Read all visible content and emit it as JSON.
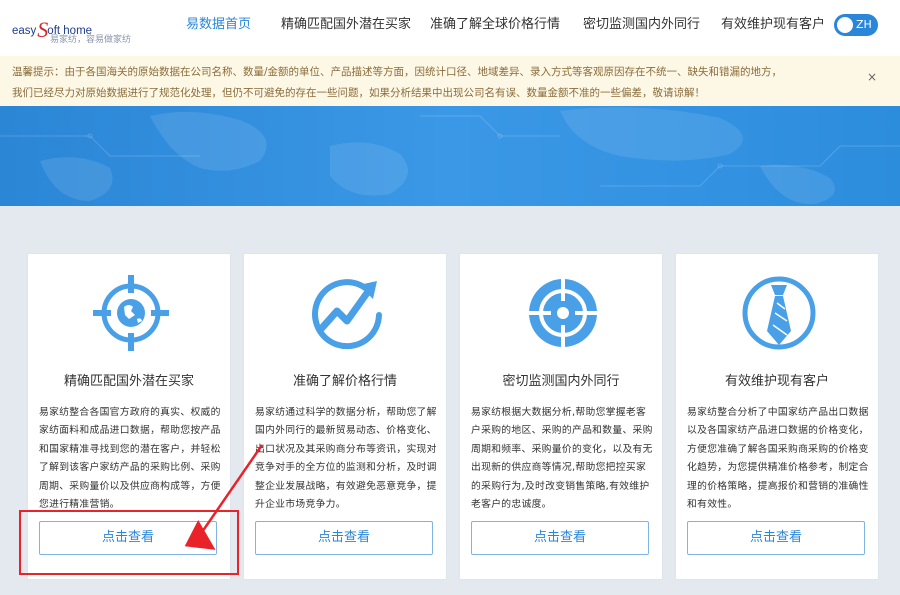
{
  "header": {
    "logo_brand_pre": "easy",
    "logo_brand_s": "S",
    "logo_brand_post": "oft home",
    "logo_slogan": "易家纺，容易做家纺",
    "nav": [
      {
        "label": "易数据首页",
        "active": true
      },
      {
        "label": "精确匹配国外潜在买家",
        "active": false
      },
      {
        "label": "准确了解全球价格行情",
        "active": false
      },
      {
        "label": "密切监测国内外同行",
        "active": false
      },
      {
        "label": "有效维护现有客户",
        "active": false
      }
    ],
    "lang_label": "ZH"
  },
  "notice": {
    "line1": "温馨提示：由于各国海关的原始数据在公司名称、数量/金额的单位、产品描述等方面，因统计口径、地域差异、录入方式等客观原因存在不统一、缺失和错漏的地方，",
    "line2": "我们已经尽力对原始数据进行了规范化处理，但仍不可避免的存在一些问题，如果分析结果中出现公司名有误、数量金额不准的一些偏差，敬请谅解！",
    "close": "×"
  },
  "cards": [
    {
      "icon": "globe-target-icon",
      "title": "精确匹配国外潜在买家",
      "desc": "易家纺整合各国官方政府的真实、权威的家纺面料和成品进口数据，帮助您按产品和国家精准寻找到您的潜在客户，并轻松了解到该客户家纺产品的采购比例、采购周期、采购量价以及供应商构成等，方便您进行精准营销。",
      "button": "点击查看"
    },
    {
      "icon": "trend-arrow-icon",
      "title": "准确了解价格行情",
      "desc": "易家纺通过科学的数据分析，帮助您了解国内外同行的最新贸易动态、价格变化、出口状况及其采购商分布等资讯，实现对竞争对手的全方位的监测和分析，及时调整企业发展战略，有效避免恶意竞争，提升企业市场竞争力。",
      "button": "点击查看"
    },
    {
      "icon": "crosshair-icon",
      "title": "密切监测国内外同行",
      "desc": "易家纺根据大数据分析,帮助您掌握老客户采购的地区、采购的产品和数量、采购周期和频率、采购量价的变化，以及有无出现新的供应商等情况,帮助您把控买家的采购行为,及时改变销售策略,有效维护老客户的忠诚度。",
      "button": "点击查看"
    },
    {
      "icon": "necktie-icon",
      "title": "有效维护现有客户",
      "desc": "易家纺整合分析了中国家纺产品出口数据以及各国家纺产品进口数据的价格变化，方便您准确了解各国采购商采购的价格变化趋势，为您提供精准价格参考，制定合理的价格策略，提高报价和营销的准确性和有效性。",
      "button": "点击查看"
    }
  ],
  "colors": {
    "accent": "#2a86d8",
    "annotation": "#e8232a",
    "notice_bg": "#fdf7e5",
    "page_bg": "#e4e9f0"
  }
}
